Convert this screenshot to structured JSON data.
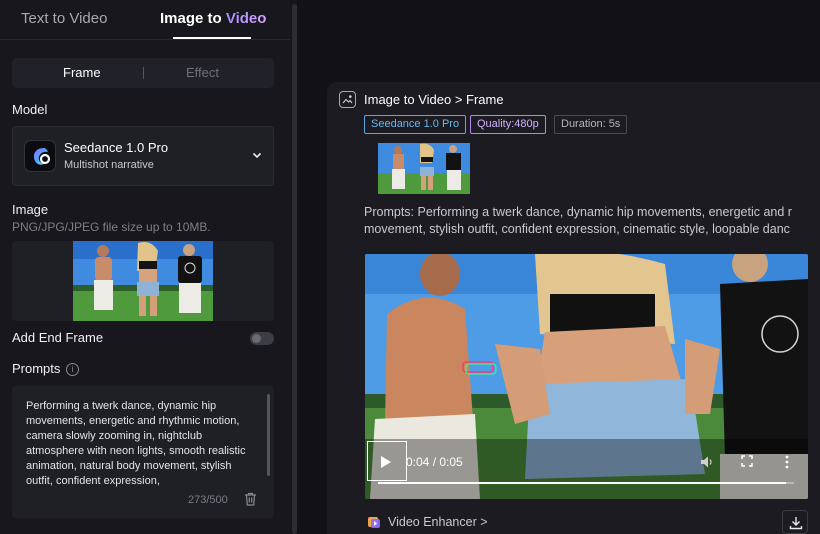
{
  "tabs": {
    "text_to_video": "Text to Video",
    "image_to_video_a": "Image to ",
    "image_to_video_b": "Video"
  },
  "segment": {
    "frame": "Frame",
    "effect": "Effect"
  },
  "model": {
    "section_label": "Model",
    "name": "Seedance 1.0 Pro",
    "subtitle": "Multishot narrative"
  },
  "image": {
    "section_label": "Image",
    "hint": "PNG/JPG/JPEG file size up to 10MB."
  },
  "end_frame": {
    "label": "Add End Frame",
    "enabled": false
  },
  "prompts": {
    "label": "Prompts",
    "text": "Performing a twerk dance, dynamic hip movements, energetic and rhythmic motion, camera slowly zooming in, nightclub atmosphere with neon lights, smooth realistic animation, natural body movement, stylish outfit, confident expression,",
    "counter": "273/500"
  },
  "result": {
    "title": "Image to Video > Frame",
    "badges": {
      "model": "Seedance 1.0 Pro",
      "quality": "Quality:480p",
      "duration": "Duration: 5s"
    },
    "prompt_line1": "Prompts: Performing a twerk dance, dynamic hip movements, energetic and r",
    "prompt_line2": "movement, stylish outfit, confident expression, cinematic style, loopable danc",
    "video": {
      "time": "0:04 / 0:05",
      "progress": 0.98
    },
    "enhancer_label": "Video Enhancer >"
  },
  "colors": {
    "accent_blue": "#6ab8f0",
    "accent_purple": "#d3b2ff",
    "panel": "#17171d",
    "card": "#1b1b21"
  },
  "icons": [
    "chevron-down-icon",
    "info-icon",
    "trash-icon",
    "image-icon",
    "play-icon",
    "volume-icon",
    "fullscreen-icon",
    "more-icon",
    "enhancer-icon",
    "download-icon"
  ]
}
